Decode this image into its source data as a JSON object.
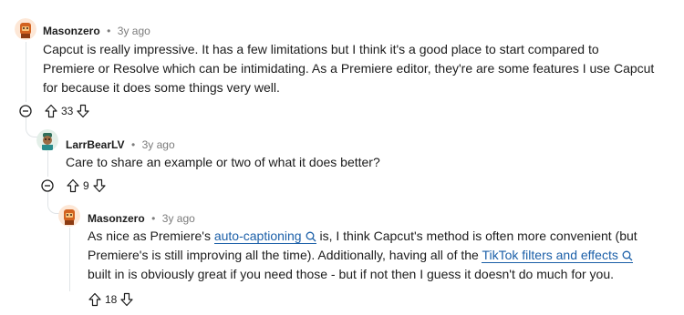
{
  "colors": {
    "link": "#1b5fa8",
    "meta": "#7c7c7c",
    "thread_line": "#e0e4e7"
  },
  "comments": [
    {
      "author": "Masonzero",
      "time": "3y ago",
      "lines": [
        "Capcut is really impressive. It has a few limitations but I think it's a good place to start compared to",
        "Premiere or Resolve which can be intimidating. As a Premiere editor, they're are some features I use Capcut",
        "for because it does some things very well."
      ],
      "votes": "33",
      "avatar_icon": "snoo-avatar-orange"
    },
    {
      "author": "LarrBearLV",
      "time": "3y ago",
      "lines": [
        "Care to share an example or two of what it does better?"
      ],
      "votes": "9",
      "avatar_icon": "snoo-avatar-teal"
    },
    {
      "author": "Masonzero",
      "time": "3y ago",
      "line1_pre": "As nice as Premiere's ",
      "line1_link": "auto-captioning",
      "line1_post": " is, I think Capcut's method is often more convenient (but",
      "line2_pre": "Premiere's is still improving all the time). Additionally, having all of the ",
      "line2_link": "TikTok filters and effects",
      "line3": "built in is obviously great if you need those - but if not then I guess it doesn't do much for you.",
      "votes": "18",
      "avatar_icon": "snoo-avatar-orange"
    }
  ],
  "separator": "•",
  "icons": [
    "collapse-icon",
    "upvote-icon",
    "downvote-icon",
    "search-icon"
  ]
}
